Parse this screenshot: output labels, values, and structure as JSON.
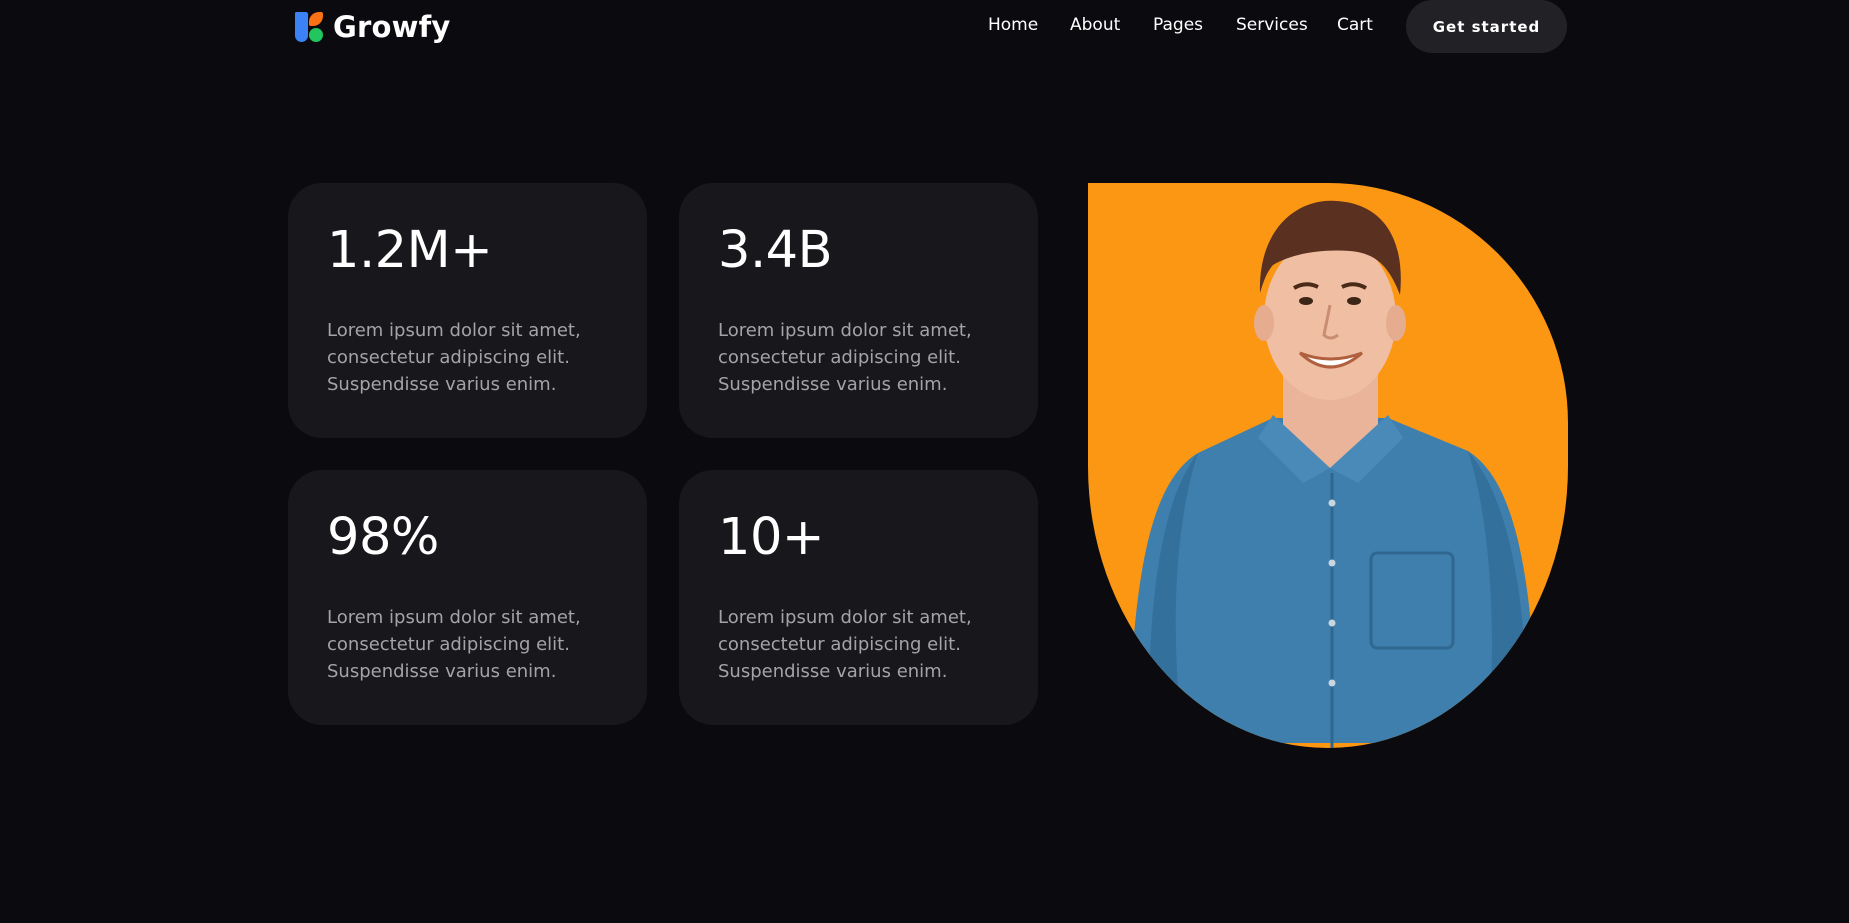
{
  "brand": {
    "name": "Growfy"
  },
  "nav": {
    "items": [
      {
        "label": "Home"
      },
      {
        "label": "About"
      },
      {
        "label": "Pages"
      },
      {
        "label": "Services"
      },
      {
        "label": "Cart"
      }
    ],
    "cta_label": "Get started"
  },
  "stats": [
    {
      "value": "1.2M+",
      "description": "Lorem ipsum dolor sit amet, consectetur adipiscing elit. Suspendisse varius enim."
    },
    {
      "value": "3.4B",
      "description": "Lorem ipsum dolor sit amet, consectetur adipiscing elit. Suspendisse varius enim."
    },
    {
      "value": "98%",
      "description": "Lorem ipsum dolor sit amet, consectetur adipiscing elit. Suspendisse varius enim."
    },
    {
      "value": "10+",
      "description": "Lorem ipsum dolor sit amet, consectetur adipiscing elit. Suspendisse varius enim."
    }
  ],
  "colors": {
    "background": "#0b0b0f",
    "card": "#18181c",
    "cta": "#222226",
    "portrait_bg": "#fb9712",
    "shirt": "#3e7fae",
    "logo_blue": "#3b82f6",
    "logo_orange": "#f97316",
    "logo_green": "#22c55e"
  }
}
